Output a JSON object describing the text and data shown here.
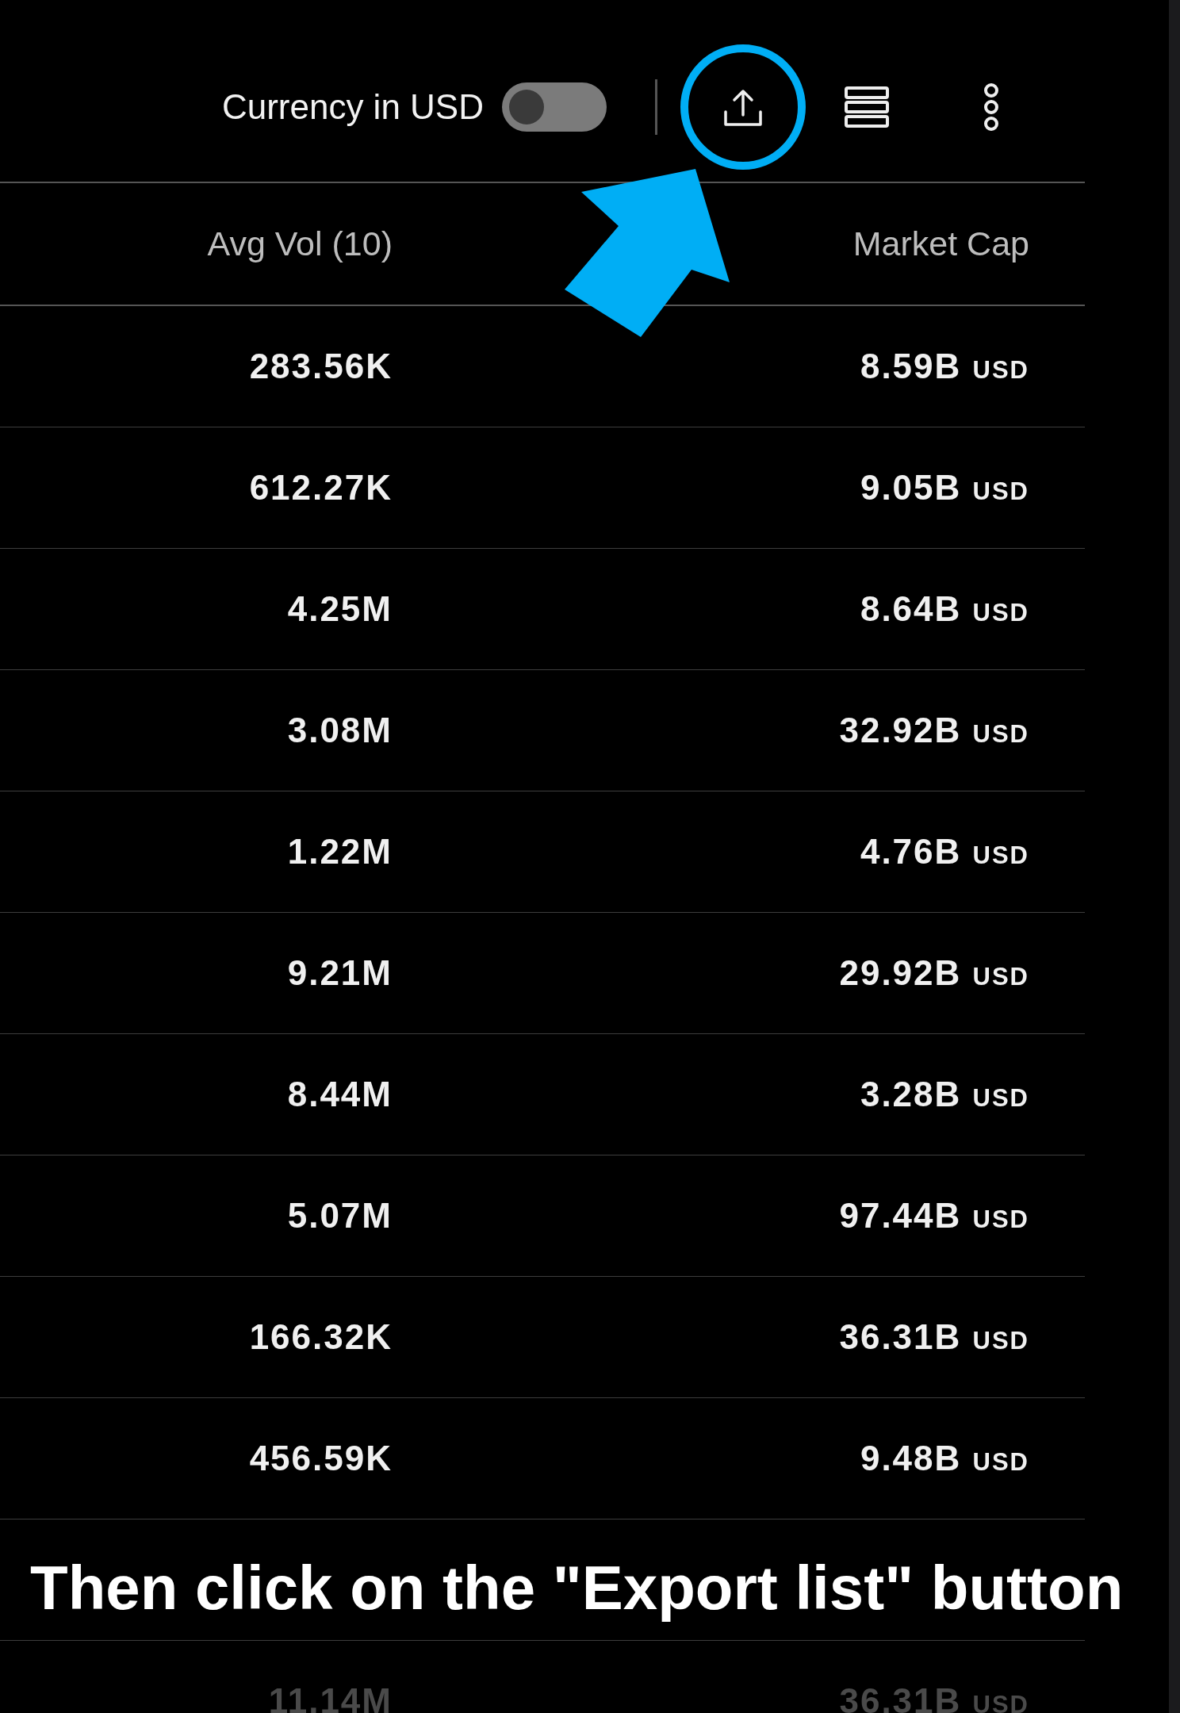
{
  "toolbar": {
    "currency_label": "Currency in USD",
    "currency_toggle": {
      "on": false
    }
  },
  "columns": [
    "Avg Vol (10)",
    "Market Cap"
  ],
  "rows": [
    {
      "avg_vol": "283.56K",
      "market_cap": "8.59B",
      "currency": "USD",
      "dimmed": false
    },
    {
      "avg_vol": "612.27K",
      "market_cap": "9.05B",
      "currency": "USD",
      "dimmed": false
    },
    {
      "avg_vol": "4.25M",
      "market_cap": "8.64B",
      "currency": "USD",
      "dimmed": false
    },
    {
      "avg_vol": "3.08M",
      "market_cap": "32.92B",
      "currency": "USD",
      "dimmed": false
    },
    {
      "avg_vol": "1.22M",
      "market_cap": "4.76B",
      "currency": "USD",
      "dimmed": false
    },
    {
      "avg_vol": "9.21M",
      "market_cap": "29.92B",
      "currency": "USD",
      "dimmed": false
    },
    {
      "avg_vol": "8.44M",
      "market_cap": "3.28B",
      "currency": "USD",
      "dimmed": false
    },
    {
      "avg_vol": "5.07M",
      "market_cap": "97.44B",
      "currency": "USD",
      "dimmed": false
    },
    {
      "avg_vol": "166.32K",
      "market_cap": "36.31B",
      "currency": "USD",
      "dimmed": false
    },
    {
      "avg_vol": "456.59K",
      "market_cap": "9.48B",
      "currency": "USD",
      "dimmed": false
    },
    {
      "avg_vol": "11.14M",
      "market_cap": "36.31B",
      "currency": "USD",
      "dimmed": true
    }
  ],
  "annotation": {
    "caption": "Then click on the \"Export list\" button"
  }
}
